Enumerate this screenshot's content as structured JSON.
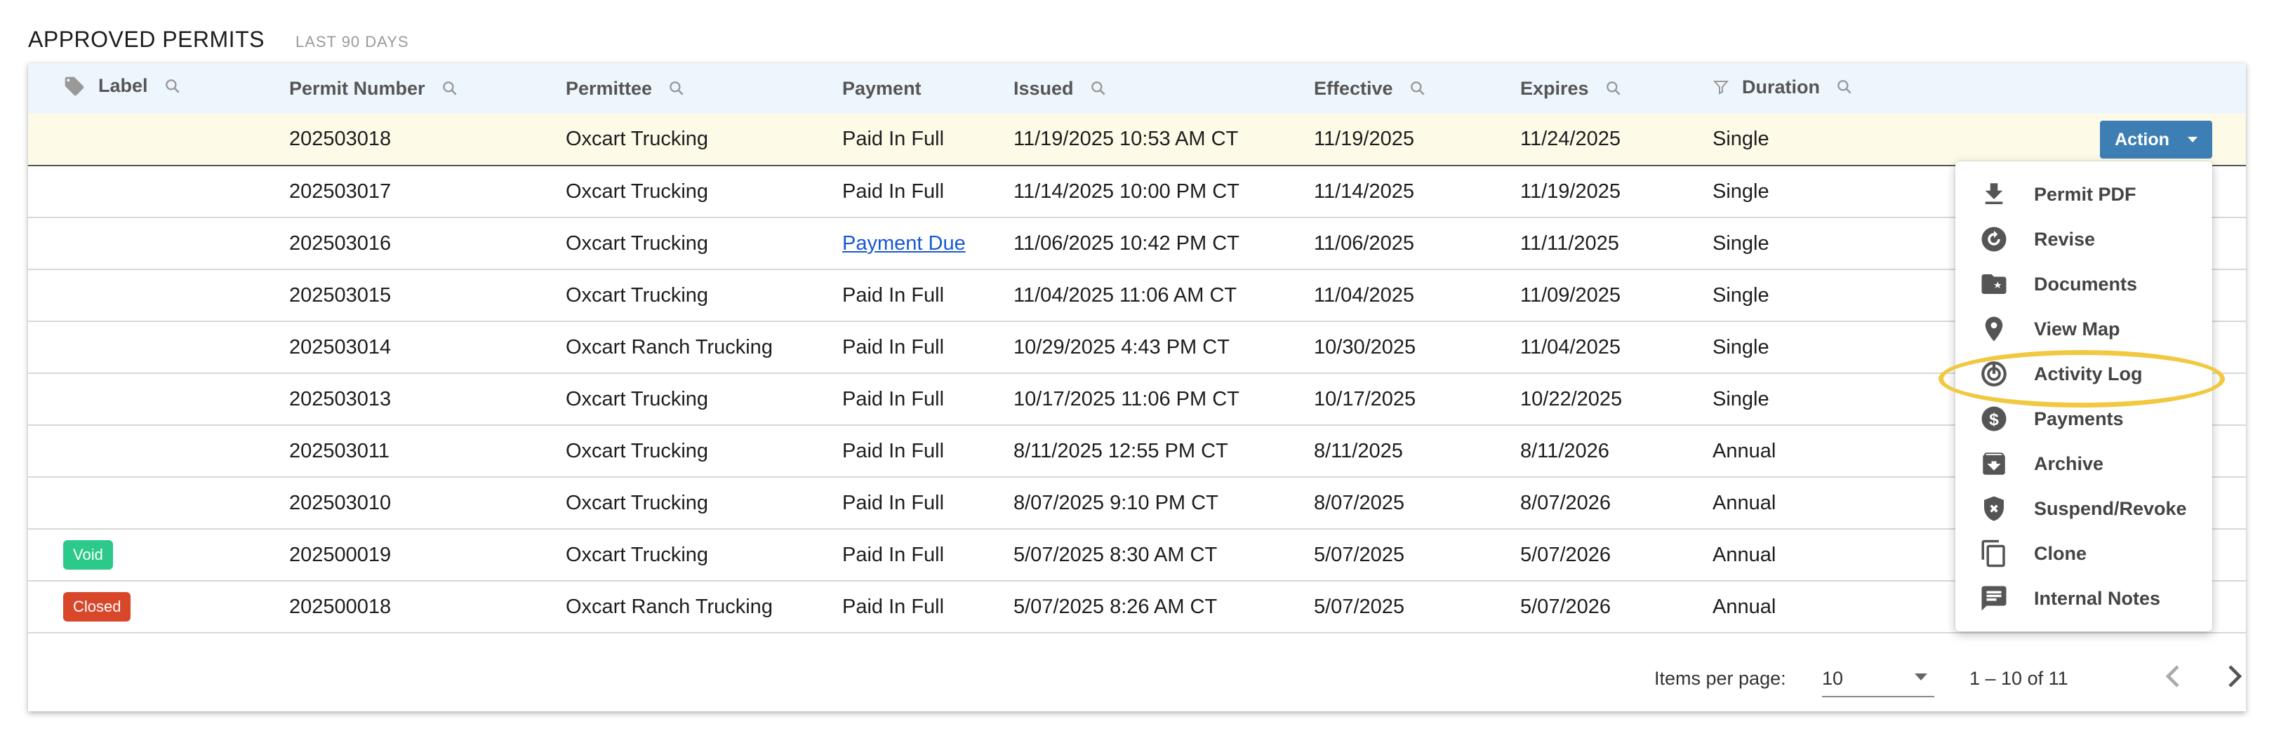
{
  "header": {
    "title": "APPROVED PERMITS",
    "subtitle": "LAST 90 DAYS"
  },
  "columns": {
    "label": "Label",
    "permit_number": "Permit Number",
    "permittee": "Permittee",
    "payment": "Payment",
    "issued": "Issued",
    "effective": "Effective",
    "expires": "Expires",
    "duration": "Duration"
  },
  "rows": [
    {
      "label": "",
      "permit": "202503018",
      "permittee": "Oxcart Trucking",
      "payment": "Paid In Full",
      "issued": "11/19/2025 10:53 AM CT",
      "effective": "11/19/2025",
      "expires": "11/24/2025",
      "duration": "Single"
    },
    {
      "label": "",
      "permit": "202503017",
      "permittee": "Oxcart Trucking",
      "payment": "Paid In Full",
      "issued": "11/14/2025 10:00 PM CT",
      "effective": "11/14/2025",
      "expires": "11/19/2025",
      "duration": "Single"
    },
    {
      "label": "",
      "permit": "202503016",
      "permittee": "Oxcart Trucking",
      "payment": "Payment Due",
      "issued": "11/06/2025 10:42 PM CT",
      "effective": "11/06/2025",
      "expires": "11/11/2025",
      "duration": "Single"
    },
    {
      "label": "",
      "permit": "202503015",
      "permittee": "Oxcart Trucking",
      "payment": "Paid In Full",
      "issued": "11/04/2025 11:06 AM CT",
      "effective": "11/04/2025",
      "expires": "11/09/2025",
      "duration": "Single"
    },
    {
      "label": "",
      "permit": "202503014",
      "permittee": "Oxcart Ranch Trucking",
      "payment": "Paid In Full",
      "issued": "10/29/2025 4:43 PM CT",
      "effective": "10/30/2025",
      "expires": "11/04/2025",
      "duration": "Single"
    },
    {
      "label": "",
      "permit": "202503013",
      "permittee": "Oxcart Trucking",
      "payment": "Paid In Full",
      "issued": "10/17/2025 11:06 PM CT",
      "effective": "10/17/2025",
      "expires": "10/22/2025",
      "duration": "Single"
    },
    {
      "label": "",
      "permit": "202503011",
      "permittee": "Oxcart Trucking",
      "payment": "Paid In Full",
      "issued": "8/11/2025 12:55 PM CT",
      "effective": "8/11/2025",
      "expires": "8/11/2026",
      "duration": "Annual"
    },
    {
      "label": "",
      "permit": "202503010",
      "permittee": "Oxcart Trucking",
      "payment": "Paid In Full",
      "issued": "8/07/2025 9:10 PM CT",
      "effective": "8/07/2025",
      "expires": "8/07/2026",
      "duration": "Annual"
    },
    {
      "label": "Void",
      "permit": "202500019",
      "permittee": "Oxcart Trucking",
      "payment": "Paid In Full",
      "issued": "5/07/2025 8:30 AM CT",
      "effective": "5/07/2025",
      "expires": "5/07/2026",
      "duration": "Annual"
    },
    {
      "label": "Closed",
      "permit": "202500018",
      "permittee": "Oxcart Ranch Trucking",
      "payment": "Paid In Full",
      "issued": "5/07/2025 8:26 AM CT",
      "effective": "5/07/2025",
      "expires": "5/07/2026",
      "duration": "Annual"
    }
  ],
  "action_button": {
    "label": "Action"
  },
  "action_menu": [
    {
      "label": "Permit PDF",
      "icon": "download-icon"
    },
    {
      "label": "Revise",
      "icon": "revise-icon"
    },
    {
      "label": "Documents",
      "icon": "folder-star-icon"
    },
    {
      "label": "View Map",
      "icon": "map-pin-icon"
    },
    {
      "label": "Activity Log",
      "icon": "activity-log-icon"
    },
    {
      "label": "Payments",
      "icon": "dollar-icon"
    },
    {
      "label": "Archive",
      "icon": "archive-icon"
    },
    {
      "label": "Suspend/Revoke",
      "icon": "shield-x-icon"
    },
    {
      "label": "Clone",
      "icon": "copy-icon"
    },
    {
      "label": "Internal Notes",
      "icon": "notes-icon"
    }
  ],
  "paginator": {
    "items_per_page_label": "Items per page:",
    "items_per_page_value": "10",
    "range": "1 – 10 of 11"
  },
  "colors": {
    "action_button": "#3d7fb5",
    "highlight_row": "#fdfae8",
    "header_row": "#eef6fd",
    "badge_void": "#2cc98a",
    "badge_closed": "#d8472a",
    "annotation": "#f1c840",
    "link": "#1857d6"
  }
}
